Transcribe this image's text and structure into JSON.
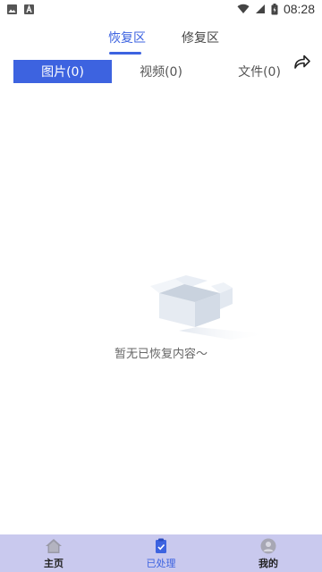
{
  "status_bar": {
    "time": "08:28",
    "icons": [
      "image-notification-icon",
      "a-notification-icon",
      "wifi-icon",
      "signal-icon",
      "battery-icon"
    ]
  },
  "top_tabs": {
    "items": [
      {
        "label": "恢复区",
        "active": true
      },
      {
        "label": "修复区",
        "active": false
      }
    ],
    "share_icon": "share-icon"
  },
  "segment_tabs": {
    "items": [
      {
        "label": "图片(0)",
        "active": true
      },
      {
        "label": "视频(0)",
        "active": false
      },
      {
        "label": "文件(0)",
        "active": false
      }
    ]
  },
  "empty_state": {
    "icon": "empty-box-icon",
    "text": "暂无已恢复内容～"
  },
  "bottom_nav": {
    "items": [
      {
        "label": "主页",
        "icon": "home-icon",
        "active": false
      },
      {
        "label": "已处理",
        "icon": "processed-icon",
        "active": true
      },
      {
        "label": "我的",
        "icon": "profile-icon",
        "active": false
      }
    ]
  },
  "colors": {
    "accent": "#3d63e0",
    "bottom_nav_bg": "#c9c9ee"
  }
}
